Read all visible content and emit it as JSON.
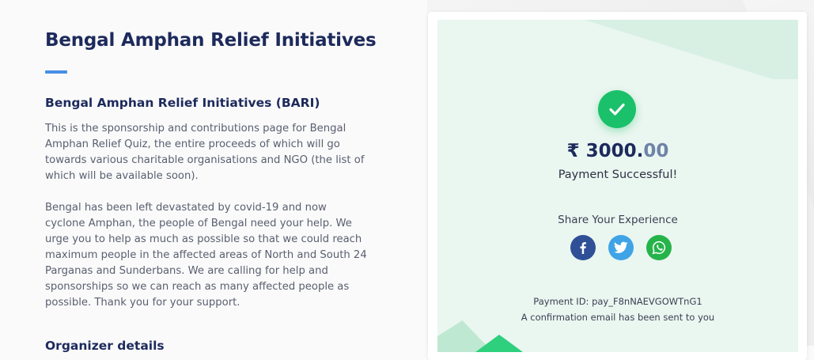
{
  "main": {
    "page_title": "Bengal Amphan Relief Initiatives",
    "section_title": "Bengal Amphan Relief Initiatives (BARI)",
    "paragraph_1": "This is the sponsorship and contributions page for Bengal Amphan Relief Quiz, the entire proceeds of which will go towards various charitable organisations and NGO (the list of which will be available soon).",
    "paragraph_2": "Bengal has been left devastated by covid-19 and now cyclone Amphan, the people of Bengal need your help. We urge you to help as much as possible so that we could reach maximum people in the affected areas of North and South 24 Parganas and Sunderbans. We are calling for help and sponsorships so we can reach as many affected people as possible. Thank you for your support.",
    "section_title_2": "Organizer details"
  },
  "payment_card": {
    "icon": "check-circle-icon",
    "amount_whole": "₹ 3000.",
    "amount_decimal": "00",
    "status": "Payment Successful!",
    "share_label": "Share Your Experience",
    "share_buttons": [
      {
        "icon": "facebook-icon"
      },
      {
        "icon": "twitter-icon"
      },
      {
        "icon": "whatsapp-icon"
      }
    ],
    "payment_id": "Payment ID: pay_F8nNAEVGOWTnG1",
    "confirmation": "A confirmation email has been sent to you"
  },
  "colors": {
    "heading": "#1d2a5c",
    "accent_bar": "#4a8ee6",
    "success": "#1bc06a",
    "card_bg": "#eaf6f0",
    "facebook": "#2f4f96",
    "twitter": "#3fa3e6",
    "whatsapp": "#25b34a"
  }
}
